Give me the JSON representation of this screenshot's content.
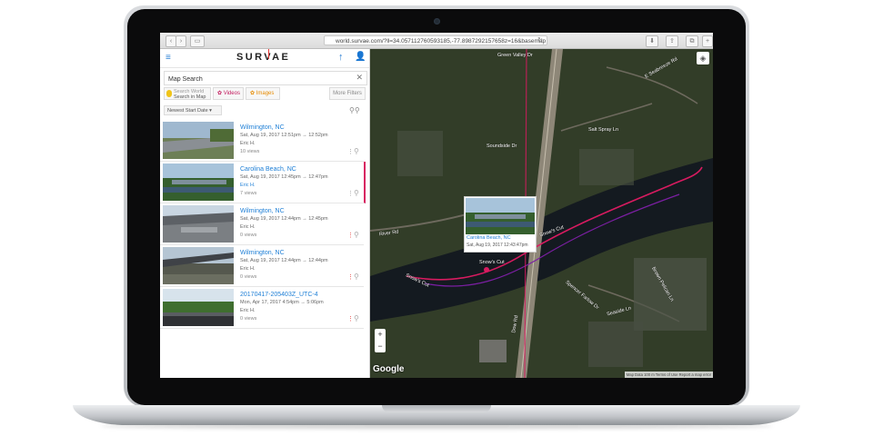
{
  "browser": {
    "url": "world.survae.com/?ll=34.057112760593185,-77.8987292157658z=16&basemap",
    "back_glyph": "‹",
    "forward_glyph": "›"
  },
  "app": {
    "logo": "SURVAE",
    "search_placeholder": "Map Search",
    "filters": {
      "search_world": "Search World",
      "search_in_map": "Search in Map",
      "videos": "Videos",
      "images": "Images",
      "more": "More Filters"
    },
    "sort": "Newest Start Date"
  },
  "results": [
    {
      "title": "Wilmington, NC",
      "meta": "Sat, Aug 19, 2017    12:51pm → 12:52pm",
      "user": "Eric H.",
      "views": "10 views",
      "selected": false
    },
    {
      "title": "Carolina Beach, NC",
      "meta": "Sat, Aug 19, 2017    12:45pm → 12:47pm",
      "user": "Eric H.",
      "views": "7 views",
      "selected": true
    },
    {
      "title": "Wilmington, NC",
      "meta": "Sat, Aug 19, 2017    12:44pm → 12:45pm",
      "user": "Eric H.",
      "views": "0 views",
      "selected": false
    },
    {
      "title": "Wilmington, NC",
      "meta": "Sat, Aug 19, 2017    12:44pm → 12:44pm",
      "user": "Eric H.",
      "views": "0 views",
      "selected": false
    },
    {
      "title": "20170417-205403Z_UTC-4",
      "meta": "Mon, Apr 17, 2017    4:54pm → 5:06pm",
      "user": "Eric H.",
      "views": "0 views",
      "selected": false
    }
  ],
  "map": {
    "popup": {
      "title": "Carolina Beach, NC",
      "meta": "Sat, Aug 19, 2017    12:43:47pm"
    },
    "labels": {
      "green_valley": "Green Valley Dr",
      "seabreeze": "E Seabreeze Rd",
      "salt_spray": "Salt Spray Ln",
      "soundside": "Soundside Dr",
      "river_rd": "River Rd",
      "snows_cut_1": "Snow's Cut",
      "snows_cut_2": "Snow's Cut",
      "snows_cut_3": "Snow's Cut",
      "spencer": "Spencer Farlow Dr",
      "seaside": "Seaside Ln",
      "brown_pelican": "Brown Pelican Ln",
      "dow_rd": "Dow Rd"
    },
    "zoom_in": "+",
    "zoom_out": "−",
    "google": "Google",
    "attribution": "Map Data  100 m  Terms of Use  Report a map error"
  },
  "colors": {
    "accent": "#1e7fd6",
    "track": "#d81b60",
    "videos": "#c2185b",
    "images": "#e68a00"
  }
}
